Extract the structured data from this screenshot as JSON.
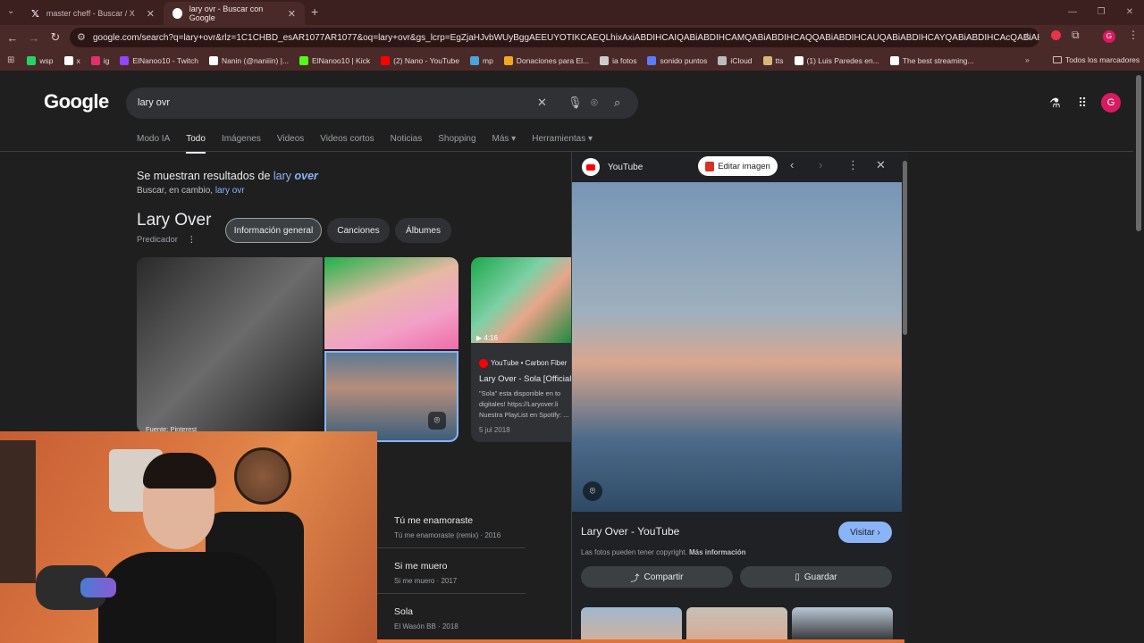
{
  "tabs": [
    {
      "title": "master cheff - Buscar / X"
    },
    {
      "title": "lary ovr - Buscar con Google"
    }
  ],
  "omnibox": {
    "url": "google.com/search?q=lary+ovr&rlz=1C1CHBD_esAR1077AR1077&oq=lary+ovr&gs_lcrp=EgZjaHJvbWUyBggAEEUYOTIKCAEQLhixAxiABDIHCAIQABiABDIHCAMQABiABDIHCAQQABiABDIHCAUQABiABDIHCAYQABiABDIHCAcQABiABDIHCAgQABiABNI..."
  },
  "bookmarks": [
    {
      "label": "wsp",
      "color": "#25d366"
    },
    {
      "label": "x",
      "color": "#ffffff"
    },
    {
      "label": "ig",
      "color": "#e1306c"
    },
    {
      "label": "ElNanoo10 - Twitch",
      "color": "#9146ff"
    },
    {
      "label": "Nanin (@naniiin) |...",
      "color": "#ffffff"
    },
    {
      "label": "ElNanoo10 | Kick",
      "color": "#53fc18"
    },
    {
      "label": "(2) Nano - YouTube",
      "color": "#ff0000"
    },
    {
      "label": "mp",
      "color": "#4aa3df"
    },
    {
      "label": "Donaciones para El...",
      "color": "#f5a623"
    },
    {
      "label": "ia fotos",
      "color": "#cccccc"
    },
    {
      "label": "sonido puntos",
      "color": "#5b7cfa"
    },
    {
      "label": "iCloud",
      "color": "#bbbbbb"
    },
    {
      "label": "tts",
      "color": "#d9b77a"
    },
    {
      "label": "(1) Luis Paredes en...",
      "color": "#ffffff"
    },
    {
      "label": "The best streaming...",
      "color": "#ffffff"
    }
  ],
  "bookmarks_all": "Todos los marcadores",
  "google": {
    "logo": "Google",
    "query": "lary ovr",
    "account_initial": "G",
    "nav": [
      "Modo IA",
      "Todo",
      "Imágenes",
      "Videos",
      "Videos cortos",
      "Noticias",
      "Shopping",
      "Más ▾",
      "Herramientas ▾"
    ]
  },
  "spelling": {
    "prefix": "Se muestran resultados de ",
    "corrected_a": "lary ",
    "corrected_b": "over",
    "instead_prefix": "Buscar, en cambio, ",
    "instead_query": "lary ovr"
  },
  "entity": {
    "name": "Lary Over",
    "subtitle": "Predicador",
    "chips": [
      "Información general",
      "Canciones",
      "Álbumes"
    ],
    "image_source": "Fuente: Pinterest"
  },
  "video": {
    "duration": "▶ 4:16",
    "source": "YouTube • Carbon Fiber",
    "title": "Lary Over - Sola [Official",
    "desc": "\"Sola\" esta disponible en to digitales! https://Laryover.li Nuestra PlayList en Spotify: ...",
    "date": "5 jul 2018"
  },
  "songs": [
    {
      "title": "Tú me enamoraste",
      "sub": "Tú me enamoraste (remix) · 2016"
    },
    {
      "title": "Si me muero",
      "sub": "Si me muero · 2017"
    },
    {
      "title": "Sola",
      "sub": "El Wasón BB · 2018"
    }
  ],
  "panel": {
    "source": "YouTube",
    "edit": "Editar imagen",
    "title": "Lary Over - YouTube",
    "visit": "Visitar ›",
    "copyright": "Las fotos pueden tener copyright.",
    "more_info": "Más información",
    "share": "Compartir",
    "save": "Guardar"
  }
}
